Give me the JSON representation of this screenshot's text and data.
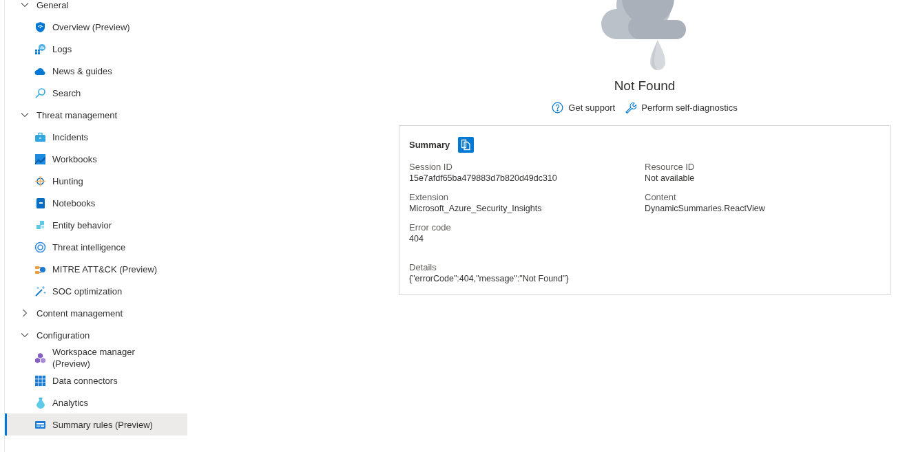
{
  "sidebar": {
    "groups": [
      {
        "label": "General",
        "expanded": true,
        "items": [
          {
            "label": "Overview (Preview)",
            "selected": false
          },
          {
            "label": "Logs",
            "selected": false
          },
          {
            "label": "News & guides",
            "selected": false
          },
          {
            "label": "Search",
            "selected": false
          }
        ]
      },
      {
        "label": "Threat management",
        "expanded": true,
        "items": [
          {
            "label": "Incidents",
            "selected": false
          },
          {
            "label": "Workbooks",
            "selected": false
          },
          {
            "label": "Hunting",
            "selected": false
          },
          {
            "label": "Notebooks",
            "selected": false
          },
          {
            "label": "Entity behavior",
            "selected": false
          },
          {
            "label": "Threat intelligence",
            "selected": false
          },
          {
            "label": "MITRE ATT&CK (Preview)",
            "selected": false
          },
          {
            "label": "SOC optimization",
            "selected": false
          }
        ]
      },
      {
        "label": "Content management",
        "expanded": false
      },
      {
        "label": "Configuration",
        "expanded": true,
        "items": [
          {
            "label": "Workspace manager (Preview)",
            "selected": false
          },
          {
            "label": "Data connectors",
            "selected": false
          },
          {
            "label": "Analytics",
            "selected": false
          },
          {
            "label": "Summary rules (Preview)",
            "selected": true
          }
        ]
      }
    ]
  },
  "error": {
    "title": "Not Found",
    "links": [
      {
        "label": "Get support"
      },
      {
        "label": "Perform self-diagnostics"
      }
    ]
  },
  "summary": {
    "title": "Summary",
    "left": [
      {
        "label": "Session ID",
        "value": "15e7afdf65ba479883d7b820d49dc310"
      },
      {
        "label": "Extension",
        "value": "Microsoft_Azure_Security_Insights"
      },
      {
        "label": "Error code",
        "value": "404"
      }
    ],
    "right": [
      {
        "label": "Resource ID",
        "value": "Not available"
      },
      {
        "label": "Content",
        "value": "DynamicSummaries.ReactView"
      }
    ],
    "details": {
      "label": "Details",
      "value": "{\"errorCode\":404,\"message\":\"Not Found\"}"
    }
  }
}
